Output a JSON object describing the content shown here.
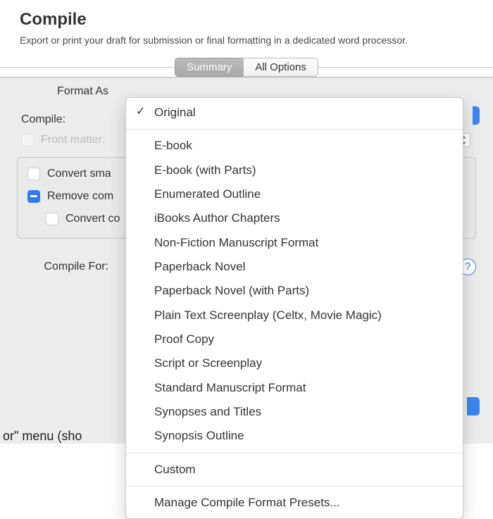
{
  "header": {
    "title": "Compile",
    "subtitle": "Export or print your draft for submission or final formatting in a dedicated word processor."
  },
  "tabs": {
    "summary": "Summary",
    "all_options": "All Options"
  },
  "panel": {
    "format_as_label": "Format As",
    "compile_label": "Compile:",
    "front_matter_label": "Front matter:",
    "compile_for_label": "Compile For:",
    "hidden_text": "or\" menu (sho"
  },
  "options_box": {
    "convert_smart": "Convert sma",
    "remove_comments": "Remove com",
    "convert_co": "Convert co"
  },
  "format_menu": {
    "selected": "Original",
    "items": [
      "Original",
      "E-book",
      "E-book (with Parts)",
      "Enumerated Outline",
      "iBooks Author Chapters",
      "Non-Fiction Manuscript Format",
      "Paperback Novel",
      "Paperback Novel (with Parts)",
      "Plain Text Screenplay (Celtx, Movie Magic)",
      "Proof Copy",
      "Script or Screenplay",
      "Standard Manuscript Format",
      "Synopses and Titles",
      "Synopsis Outline"
    ],
    "custom": "Custom",
    "manage": "Manage Compile Format Presets..."
  },
  "help": {
    "symbol": "?"
  }
}
